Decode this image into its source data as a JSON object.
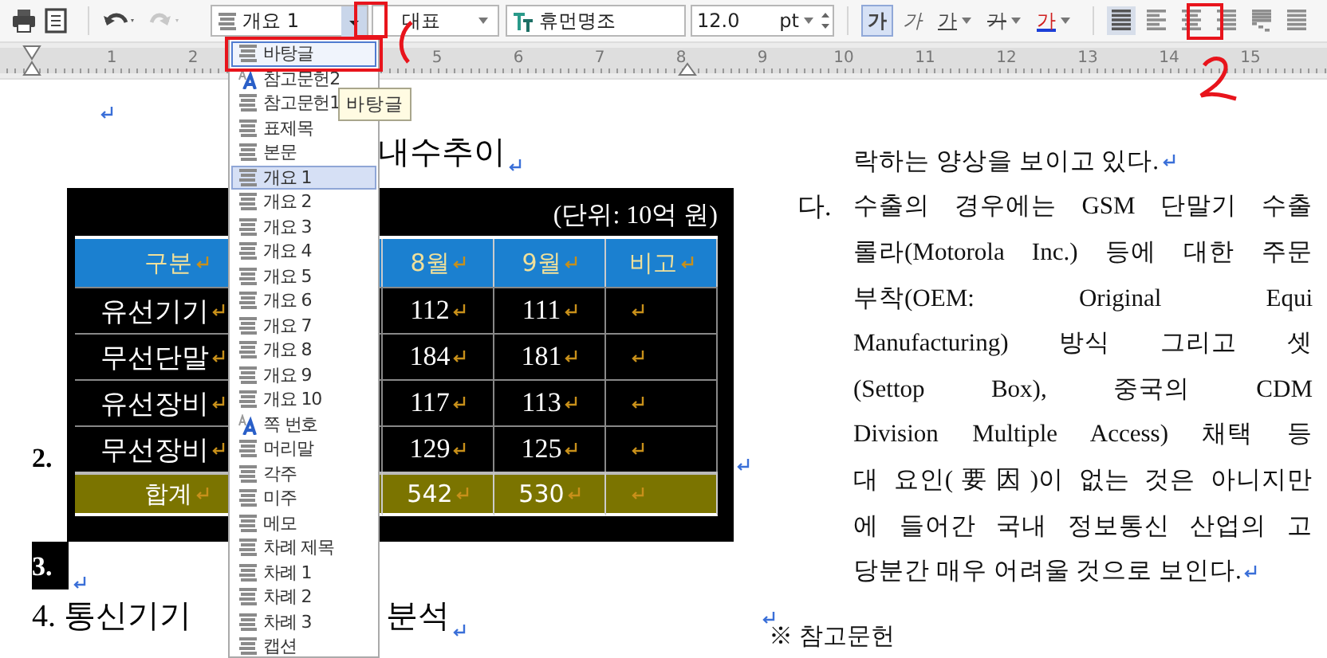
{
  "toolbar": {
    "style_field": {
      "value": "개요 1"
    },
    "language_field": {
      "value": "대표"
    },
    "font_field": {
      "value": "휴먼명조"
    },
    "size_field": {
      "value": "12.0",
      "unit": "pt"
    },
    "char_buttons": [
      {
        "label": "가",
        "kind": "bold",
        "selected": true
      },
      {
        "label": "가",
        "kind": "italic",
        "selected": false
      },
      {
        "label": "가",
        "kind": "underline",
        "selected": false
      },
      {
        "label": "가",
        "kind": "strikeout",
        "selected": false
      },
      {
        "label": "가",
        "kind": "color",
        "selected": false
      }
    ],
    "align_buttons": [
      {
        "kind": "justify",
        "selected": true
      },
      {
        "kind": "left",
        "selected": false
      },
      {
        "kind": "center",
        "selected": false
      },
      {
        "kind": "right",
        "selected": false
      },
      {
        "kind": "distribute",
        "selected": false
      },
      {
        "kind": "divide",
        "selected": false
      }
    ]
  },
  "ruler": {
    "numbers": [
      "1",
      "2",
      "5",
      "6",
      "7",
      "8",
      "9",
      "10",
      "11",
      "12",
      "13",
      "14",
      "15"
    ]
  },
  "style_list": {
    "items": [
      {
        "label": "바탕글",
        "kind": "paragraph",
        "hovered": true,
        "selected": false
      },
      {
        "label": "참고문헌2",
        "kind": "character",
        "hovered": false,
        "selected": false
      },
      {
        "label": "참고문헌1",
        "kind": "paragraph",
        "hovered": false,
        "selected": false
      },
      {
        "label": "표제목",
        "kind": "paragraph",
        "hovered": false,
        "selected": false
      },
      {
        "label": "본문",
        "kind": "paragraph",
        "hovered": false,
        "selected": false
      },
      {
        "label": "개요 1",
        "kind": "paragraph",
        "hovered": false,
        "selected": true
      },
      {
        "label": "개요 2",
        "kind": "paragraph",
        "hovered": false,
        "selected": false
      },
      {
        "label": "개요 3",
        "kind": "paragraph",
        "hovered": false,
        "selected": false
      },
      {
        "label": "개요 4",
        "kind": "paragraph",
        "hovered": false,
        "selected": false
      },
      {
        "label": "개요 5",
        "kind": "paragraph",
        "hovered": false,
        "selected": false
      },
      {
        "label": "개요 6",
        "kind": "paragraph",
        "hovered": false,
        "selected": false
      },
      {
        "label": "개요 7",
        "kind": "paragraph",
        "hovered": false,
        "selected": false
      },
      {
        "label": "개요 8",
        "kind": "paragraph",
        "hovered": false,
        "selected": false
      },
      {
        "label": "개요 9",
        "kind": "paragraph",
        "hovered": false,
        "selected": false
      },
      {
        "label": "개요 10",
        "kind": "paragraph",
        "hovered": false,
        "selected": false
      },
      {
        "label": "쪽 번호",
        "kind": "character",
        "hovered": false,
        "selected": false
      },
      {
        "label": "머리말",
        "kind": "paragraph",
        "hovered": false,
        "selected": false
      },
      {
        "label": "각주",
        "kind": "paragraph",
        "hovered": false,
        "selected": false
      },
      {
        "label": "미주",
        "kind": "paragraph",
        "hovered": false,
        "selected": false
      },
      {
        "label": "메모",
        "kind": "paragraph",
        "hovered": false,
        "selected": false
      },
      {
        "label": "차례 제목",
        "kind": "paragraph",
        "hovered": false,
        "selected": false
      },
      {
        "label": "차례 1",
        "kind": "paragraph",
        "hovered": false,
        "selected": false
      },
      {
        "label": "차례 2",
        "kind": "paragraph",
        "hovered": false,
        "selected": false
      },
      {
        "label": "차례 3",
        "kind": "paragraph",
        "hovered": false,
        "selected": false
      },
      {
        "label": "캡션",
        "kind": "paragraph",
        "hovered": false,
        "selected": false
      }
    ]
  },
  "tooltip": "바탕글",
  "document": {
    "left": {
      "heading": "내수추이",
      "table": {
        "unit": "(단위: 10억 원)",
        "columns": [
          "구분",
          "8월",
          "9월",
          "비고"
        ],
        "rows": [
          {
            "cells": [
              "유선기기",
              "112",
              "111"
            ]
          },
          {
            "cells": [
              "무선단말",
              "184",
              "181"
            ]
          },
          {
            "cells": [
              "유선장비",
              "117",
              "113"
            ]
          },
          {
            "cells": [
              "무선장비",
              "129",
              "125"
            ]
          }
        ],
        "total": {
          "cells": [
            "합계",
            "542",
            "530"
          ]
        }
      },
      "item_2": "2.",
      "item_3": {
        "text": "3.",
        "selected": true
      },
      "item_4": {
        "text": "4. 통신기기",
        "tail": "분석"
      }
    },
    "right": {
      "lines": [
        {
          "text": "락하는 양상을 보이고 있다.",
          "justify": false,
          "end": true
        },
        {
          "marker": "다.",
          "text": "수출의 경우에는 GSM 단말기 수출",
          "justify": true,
          "end": false
        },
        {
          "text": "롤라(Motorola Inc.) 등에 대한 주문",
          "justify": true,
          "end": false
        },
        {
          "text": "부착(OEM: Original Equi",
          "justify": true,
          "end": false
        },
        {
          "text": "Manufacturing) 방식 그리고 셋",
          "justify": true,
          "end": false
        },
        {
          "text": "(Settop Box), 중국의 CDM",
          "justify": true,
          "end": false
        },
        {
          "text": "Division Multiple Access) 채택 등",
          "justify": true,
          "end": false
        },
        {
          "text": "대 요인(要因)이 없는 것은 아니지만",
          "justify": true,
          "end": false
        },
        {
          "text": "에 들어간 국내 정보통신 산업의 고",
          "justify": true,
          "end": false
        },
        {
          "text": "당분간 매우 어려울 것으로 보인다.",
          "justify": false,
          "end": true
        }
      ],
      "footer": "※ 참고문헌"
    }
  }
}
